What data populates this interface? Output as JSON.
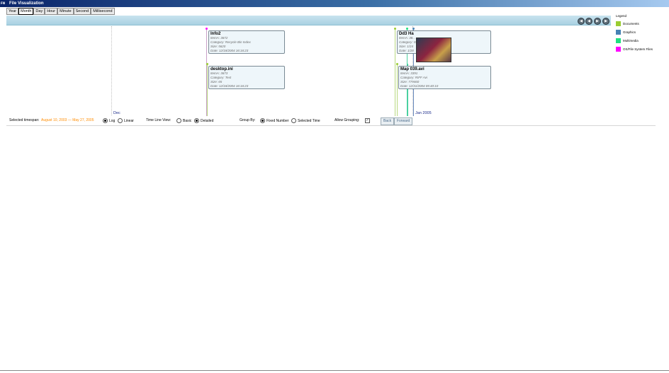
{
  "window": {
    "icon_text": "FN",
    "title": "File Visualization"
  },
  "tabs": [
    "Year",
    "Month",
    "Day",
    "Hour",
    "Minute",
    "Second",
    "Millisecond"
  ],
  "active_tab": "Month",
  "nav_buttons": [
    "◀",
    "◀",
    "▶",
    "▶"
  ],
  "legend": {
    "title": "Legend",
    "items": [
      {
        "label": "Documents",
        "color": "#9acd32"
      },
      {
        "label": "Graphics",
        "color": "#4682b4"
      },
      {
        "label": "Multimedia",
        "color": "#20e080"
      },
      {
        "label": "OS/File System Files",
        "color": "#ff00ff"
      }
    ]
  },
  "timeline": {
    "axis_labels": [
      "Dec",
      "Jan 2005"
    ],
    "cards": [
      {
        "title": "Info2",
        "lines": [
          "ItemA: 3672",
          "Category: Recycle Bin Index",
          "Size: 5620",
          "Date: 12/18/2004 16:16:23"
        ]
      },
      {
        "title": "desktop.ini",
        "lines": [
          "ItemA: 3673",
          "Category: Text",
          "Size: 65",
          "Date: 12/18/2004 16:16:23"
        ]
      },
      {
        "title": "Dd3 Ha",
        "lines": [
          "ItemA: 38...",
          "Category: Gr...",
          "Size: 1/24",
          "Date: 1/28"
        ]
      },
      {
        "title": "Map 039.avi",
        "lines": [
          "ItemA: 3391",
          "Category: RIFF Avi",
          "Size: 779460",
          "Date: 12/31/2004 05:40:10"
        ]
      }
    ]
  },
  "controls": {
    "timespan_label": "Selected timespan:",
    "timespan_value": "August 10, 2003 — May 27, 2005",
    "scale_options": [
      "Log",
      "Linear"
    ],
    "scale_selected": "Log",
    "view_label": "Time Line View:",
    "view_options": [
      "Basic",
      "Detailed"
    ],
    "view_selected": "Detailed",
    "group_label": "Group By:",
    "group_options": [
      "Fixed Number",
      "Selected Time"
    ],
    "group_selected": "Fixed Number",
    "allow_grouping_label": "Allow Grouping:",
    "allow_grouping_checked": true,
    "back_label": "Back",
    "forward_label": "Forward"
  }
}
